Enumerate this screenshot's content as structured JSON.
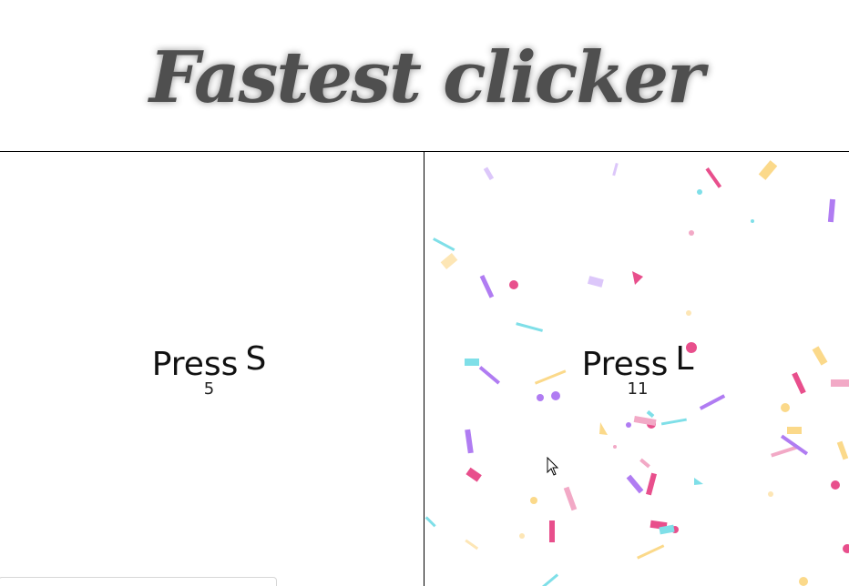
{
  "header": {
    "title": "Fastest clicker"
  },
  "players": [
    {
      "prompt": "Press",
      "key": "S",
      "count": "5"
    },
    {
      "prompt": "Press",
      "key": "L",
      "count": "11"
    }
  ],
  "colors": {
    "title": "#4f4f4f",
    "divider": "#000000",
    "confetti_pink": "#e84f8c",
    "confetti_purple": "#b07cf2",
    "confetti_cyan": "#7fdfe8",
    "confetti_yellow": "#fbd98a",
    "confetti_lightpink": "#f2a9c6"
  },
  "icons": {
    "cursor": "mouse-pointer-icon"
  }
}
